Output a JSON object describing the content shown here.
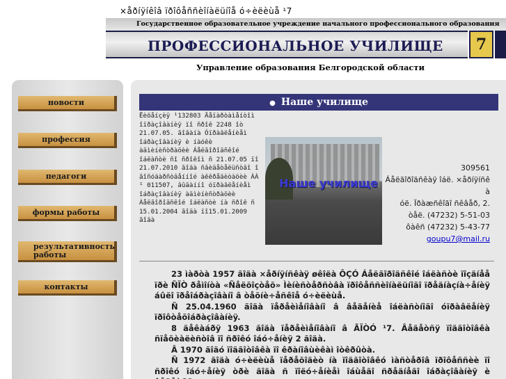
{
  "browser_title": "×åðíÿíêîâ ïðîôåññèîíàëüíîå ó÷èëèùå ¹7",
  "header": {
    "subtitle": "Государственное образовательное учреждение начального профессионального образования",
    "title": "ПРОФЕССИОНАЛЬНОЕ УЧИЛИЩЕ",
    "number": "7",
    "region": "Управление образования Белгородской области"
  },
  "nav": {
    "items": [
      {
        "label": "новости"
      },
      {
        "label": "профессия"
      },
      {
        "label": "педагоги"
      },
      {
        "label": "формы работы"
      },
      {
        "label": "результативность работы"
      },
      {
        "label": "контакты"
      }
    ]
  },
  "content": {
    "title_bullet": "●",
    "title": "Наше училище",
    "license_text": "Ëèöåíçèÿ ¹132803 Äåïàðòàìåíòîì îïðàçîâàíèÿ ïî ñðîê 2248 îò 21.07.05. ãîâàíà Óïðàâëåíèåì îáðàçîâàíèÿ è íàóêè àäìèíèñòðàöèè Áåëãîðîäñêîé îáëàñòè ñî ñðîêîì ñ 21.07.05 ïî 21.07.2010 ãîäà ñâèäåòåëüñòâî î ãîñóäàðñòâåííîé àêêðåäèòàöèè ÀÀ ¹ 011507, âûäàííî óïðàâëåíèåì îáðàçîâàíèÿ àäìèíèñòðàöèè Áåëãîðîäñêîé îáëàñòè íà ñðîê ñ 15.01.2004 ãîäà ïî15.01.2009 ãîäà",
    "photo_label": "Наше училище",
    "address": {
      "line1": "309561",
      "line2": "Áåëãîðîäñêàÿ îáë. ×åðíÿíñê à",
      "line3": "óë. Ïðàæñêîãî ñêâåð, 2.",
      "line4": "òåë. (47232) 5-51-03",
      "line5": "ôàêñ (47232) 5-43-77",
      "email": "goupu7@mail.ru"
    },
    "paragraphs": [
      "23 ìàðòà 1957 ãîäà ×åðíÿíñêàÿ øêîëà ÔÇÓ Áåëãîðîäñêîé îáëàñòè ïîçäíåå ïðè ÑÏÒ ðåìîíòà «Ñåëõîçòåõ» Ìèíèñòåðñòâà ïðîôåññèîíàëüíîãî ïðåäíàçíà÷åíèÿ áûëî ïðåîáðàçîâàíî â òåõíè÷åñêîå ó÷èëèùå.",
      "Ñ 25.04.1960 ãîäà ïåðåèìåíîâàíî â âåäåíèå îáëàñòíîãî óïðàâëåíèÿ ïðîôòåõîáðàçîâàíèÿ.",
      "8 äåêàáðÿ 1963 ãîäà ïåðåèìåíîâàíî â ÃÏÒÓ ¹7. Âåäåòñÿ ïîäãîòîâêà ñïåöèàëèñòîâ ïî ñðîêó îáó÷åíèÿ 2 ãîäà.",
      "Â 1970 ãîäó ïîäãîòîâêà ïî êðàíîâùèêàì îòêðûòà.",
      "Ñ 1972 ãîäà ó÷èëèùå ïåðåõîäèò íà ïîäãîòîâêó ìàñòåðîâ ïðîôåññèè ïî ñðîêó îáó÷åíèÿ òðè ãîäà ñ ïîëó÷åíèåì îáùåãî ñðåäíåãî îáðàçîâàíèÿ è âåäåòñÿ"
    ]
  }
}
